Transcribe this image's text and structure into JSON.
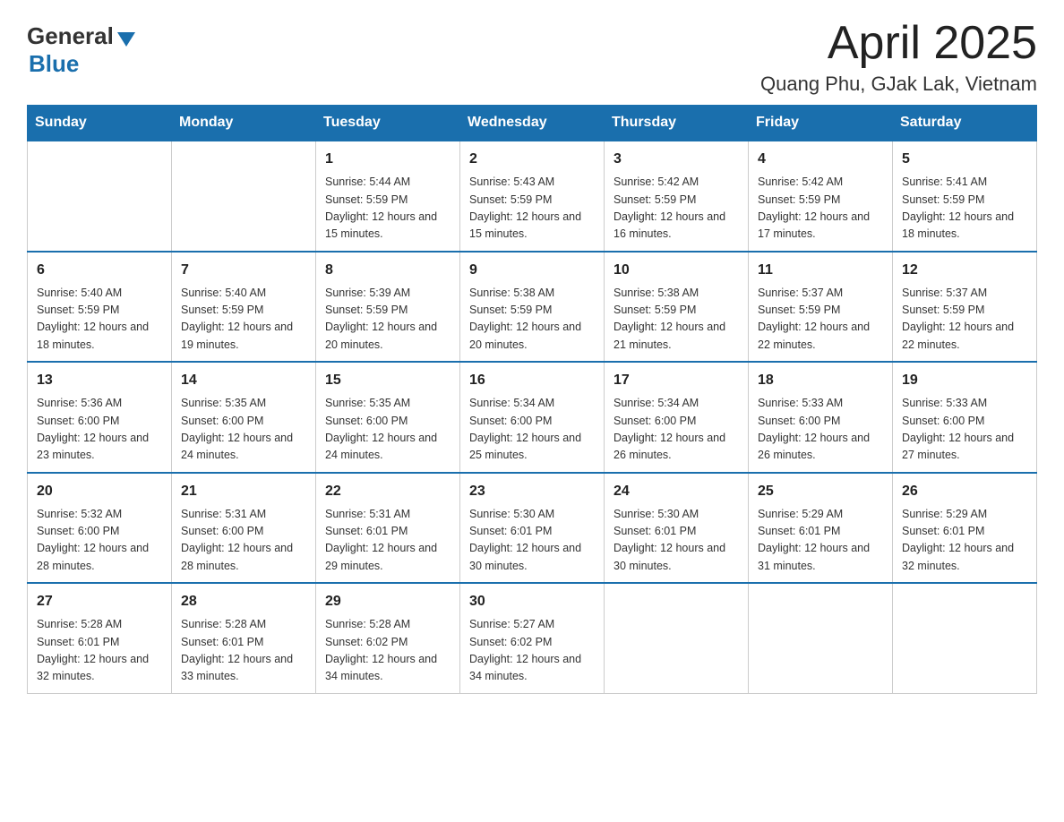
{
  "logo": {
    "general": "General",
    "blue": "Blue"
  },
  "header": {
    "title": "April 2025",
    "subtitle": "Quang Phu, GJak Lak, Vietnam"
  },
  "days_of_week": [
    "Sunday",
    "Monday",
    "Tuesday",
    "Wednesday",
    "Thursday",
    "Friday",
    "Saturday"
  ],
  "weeks": [
    [
      {
        "day": "",
        "sunrise": "",
        "sunset": "",
        "daylight": ""
      },
      {
        "day": "",
        "sunrise": "",
        "sunset": "",
        "daylight": ""
      },
      {
        "day": "1",
        "sunrise": "Sunrise: 5:44 AM",
        "sunset": "Sunset: 5:59 PM",
        "daylight": "Daylight: 12 hours and 15 minutes."
      },
      {
        "day": "2",
        "sunrise": "Sunrise: 5:43 AM",
        "sunset": "Sunset: 5:59 PM",
        "daylight": "Daylight: 12 hours and 15 minutes."
      },
      {
        "day": "3",
        "sunrise": "Sunrise: 5:42 AM",
        "sunset": "Sunset: 5:59 PM",
        "daylight": "Daylight: 12 hours and 16 minutes."
      },
      {
        "day": "4",
        "sunrise": "Sunrise: 5:42 AM",
        "sunset": "Sunset: 5:59 PM",
        "daylight": "Daylight: 12 hours and 17 minutes."
      },
      {
        "day": "5",
        "sunrise": "Sunrise: 5:41 AM",
        "sunset": "Sunset: 5:59 PM",
        "daylight": "Daylight: 12 hours and 18 minutes."
      }
    ],
    [
      {
        "day": "6",
        "sunrise": "Sunrise: 5:40 AM",
        "sunset": "Sunset: 5:59 PM",
        "daylight": "Daylight: 12 hours and 18 minutes."
      },
      {
        "day": "7",
        "sunrise": "Sunrise: 5:40 AM",
        "sunset": "Sunset: 5:59 PM",
        "daylight": "Daylight: 12 hours and 19 minutes."
      },
      {
        "day": "8",
        "sunrise": "Sunrise: 5:39 AM",
        "sunset": "Sunset: 5:59 PM",
        "daylight": "Daylight: 12 hours and 20 minutes."
      },
      {
        "day": "9",
        "sunrise": "Sunrise: 5:38 AM",
        "sunset": "Sunset: 5:59 PM",
        "daylight": "Daylight: 12 hours and 20 minutes."
      },
      {
        "day": "10",
        "sunrise": "Sunrise: 5:38 AM",
        "sunset": "Sunset: 5:59 PM",
        "daylight": "Daylight: 12 hours and 21 minutes."
      },
      {
        "day": "11",
        "sunrise": "Sunrise: 5:37 AM",
        "sunset": "Sunset: 5:59 PM",
        "daylight": "Daylight: 12 hours and 22 minutes."
      },
      {
        "day": "12",
        "sunrise": "Sunrise: 5:37 AM",
        "sunset": "Sunset: 5:59 PM",
        "daylight": "Daylight: 12 hours and 22 minutes."
      }
    ],
    [
      {
        "day": "13",
        "sunrise": "Sunrise: 5:36 AM",
        "sunset": "Sunset: 6:00 PM",
        "daylight": "Daylight: 12 hours and 23 minutes."
      },
      {
        "day": "14",
        "sunrise": "Sunrise: 5:35 AM",
        "sunset": "Sunset: 6:00 PM",
        "daylight": "Daylight: 12 hours and 24 minutes."
      },
      {
        "day": "15",
        "sunrise": "Sunrise: 5:35 AM",
        "sunset": "Sunset: 6:00 PM",
        "daylight": "Daylight: 12 hours and 24 minutes."
      },
      {
        "day": "16",
        "sunrise": "Sunrise: 5:34 AM",
        "sunset": "Sunset: 6:00 PM",
        "daylight": "Daylight: 12 hours and 25 minutes."
      },
      {
        "day": "17",
        "sunrise": "Sunrise: 5:34 AM",
        "sunset": "Sunset: 6:00 PM",
        "daylight": "Daylight: 12 hours and 26 minutes."
      },
      {
        "day": "18",
        "sunrise": "Sunrise: 5:33 AM",
        "sunset": "Sunset: 6:00 PM",
        "daylight": "Daylight: 12 hours and 26 minutes."
      },
      {
        "day": "19",
        "sunrise": "Sunrise: 5:33 AM",
        "sunset": "Sunset: 6:00 PM",
        "daylight": "Daylight: 12 hours and 27 minutes."
      }
    ],
    [
      {
        "day": "20",
        "sunrise": "Sunrise: 5:32 AM",
        "sunset": "Sunset: 6:00 PM",
        "daylight": "Daylight: 12 hours and 28 minutes."
      },
      {
        "day": "21",
        "sunrise": "Sunrise: 5:31 AM",
        "sunset": "Sunset: 6:00 PM",
        "daylight": "Daylight: 12 hours and 28 minutes."
      },
      {
        "day": "22",
        "sunrise": "Sunrise: 5:31 AM",
        "sunset": "Sunset: 6:01 PM",
        "daylight": "Daylight: 12 hours and 29 minutes."
      },
      {
        "day": "23",
        "sunrise": "Sunrise: 5:30 AM",
        "sunset": "Sunset: 6:01 PM",
        "daylight": "Daylight: 12 hours and 30 minutes."
      },
      {
        "day": "24",
        "sunrise": "Sunrise: 5:30 AM",
        "sunset": "Sunset: 6:01 PM",
        "daylight": "Daylight: 12 hours and 30 minutes."
      },
      {
        "day": "25",
        "sunrise": "Sunrise: 5:29 AM",
        "sunset": "Sunset: 6:01 PM",
        "daylight": "Daylight: 12 hours and 31 minutes."
      },
      {
        "day": "26",
        "sunrise": "Sunrise: 5:29 AM",
        "sunset": "Sunset: 6:01 PM",
        "daylight": "Daylight: 12 hours and 32 minutes."
      }
    ],
    [
      {
        "day": "27",
        "sunrise": "Sunrise: 5:28 AM",
        "sunset": "Sunset: 6:01 PM",
        "daylight": "Daylight: 12 hours and 32 minutes."
      },
      {
        "day": "28",
        "sunrise": "Sunrise: 5:28 AM",
        "sunset": "Sunset: 6:01 PM",
        "daylight": "Daylight: 12 hours and 33 minutes."
      },
      {
        "day": "29",
        "sunrise": "Sunrise: 5:28 AM",
        "sunset": "Sunset: 6:02 PM",
        "daylight": "Daylight: 12 hours and 34 minutes."
      },
      {
        "day": "30",
        "sunrise": "Sunrise: 5:27 AM",
        "sunset": "Sunset: 6:02 PM",
        "daylight": "Daylight: 12 hours and 34 minutes."
      },
      {
        "day": "",
        "sunrise": "",
        "sunset": "",
        "daylight": ""
      },
      {
        "day": "",
        "sunrise": "",
        "sunset": "",
        "daylight": ""
      },
      {
        "day": "",
        "sunrise": "",
        "sunset": "",
        "daylight": ""
      }
    ]
  ]
}
